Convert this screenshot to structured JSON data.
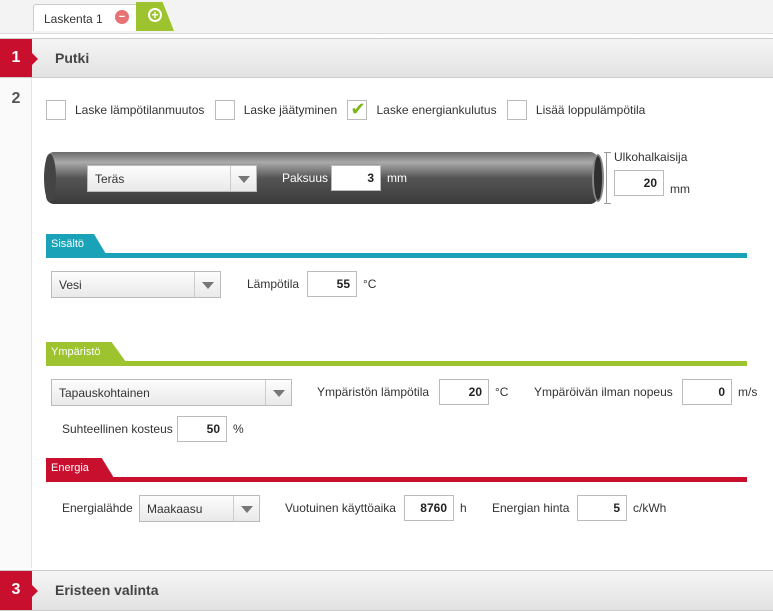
{
  "tabs": {
    "active_label": "Laskenta 1",
    "close_symbol": "−",
    "add_symbol": "+"
  },
  "steps": {
    "step1": {
      "number": "1",
      "title": "Putki"
    },
    "step2": {
      "number": "2"
    },
    "step3": {
      "number": "3",
      "title": "Eristeen valinta"
    }
  },
  "options": {
    "temp_change": {
      "label": "Laske lämpötilanmuutos",
      "checked": false
    },
    "freezing": {
      "label": "Laske jäätyminen",
      "checked": false
    },
    "energy": {
      "label": "Laske energiankulutus",
      "checked": true
    },
    "final_temp": {
      "label": "Lisää loppulämpötila",
      "checked": false
    }
  },
  "pipe": {
    "material": "Teräs",
    "thickness_label": "Paksuus",
    "thickness": "3",
    "thickness_unit": "mm",
    "outer_diameter_label": "Ulkohalkaisija",
    "outer_diameter": "20",
    "outer_diameter_unit": "mm"
  },
  "content": {
    "header": "Sisältö",
    "medium": "Vesi",
    "temp_label": "Lämpötila",
    "temp": "55",
    "temp_unit": "°C"
  },
  "environment": {
    "header": "Ympäristö",
    "mode": "Tapauskohtainen",
    "env_temp_label": "Ympäristön lämpötila",
    "env_temp": "20",
    "env_temp_unit": "°C",
    "air_speed_label": "Ympäröivän ilman nopeus",
    "air_speed": "0",
    "air_speed_unit": "m/s",
    "humidity_label": "Suhteellinen kosteus",
    "humidity": "50",
    "humidity_unit": "%"
  },
  "energy": {
    "header": "Energia",
    "source_label": "Energialähde",
    "source": "Maakaasu",
    "hours_label": "Vuotuinen käyttöaika",
    "hours": "8760",
    "hours_unit": "h",
    "price_label": "Energian hinta",
    "price": "5",
    "price_unit": "c/kWh"
  },
  "colors": {
    "red": "#c8102e",
    "teal": "#1aa3b8",
    "green": "#9dc32f"
  }
}
